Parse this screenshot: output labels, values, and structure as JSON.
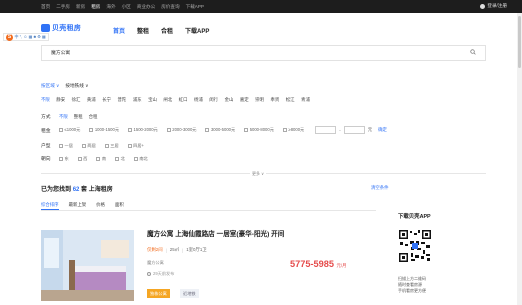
{
  "topnav": {
    "items": [
      "首页",
      "二手房",
      "新房",
      "租房",
      "海外",
      "小区",
      "商业办公",
      "房价查询",
      "下载APP"
    ],
    "active_index": 3,
    "login": "登录/注册"
  },
  "ime": {
    "logo": "S",
    "glyphs": "中 °, ☺ ▦ ♣ ⚙ ▦"
  },
  "header": {
    "logo": "贝壳租房",
    "nav": [
      "首页",
      "整租",
      "合租",
      "下载APP"
    ],
    "active_index": 0
  },
  "search": {
    "value": "魔方公寓"
  },
  "filters": {
    "tabs": [
      "按区域 ∨",
      "按地铁线 ∨"
    ],
    "districts": [
      "不限",
      "静安",
      "徐汇",
      "黄浦",
      "长宁",
      "普陀",
      "浦东",
      "宝山",
      "闸北",
      "虹口",
      "杨浦",
      "闵行",
      "金山",
      "嘉定",
      "崇明",
      "奉贤",
      "松江",
      "青浦"
    ],
    "method": {
      "label": "方式",
      "options": [
        "不限",
        "整租",
        "合租"
      ]
    },
    "rent": {
      "label": "租金",
      "options": [
        "≤1000元",
        "1000-1500元",
        "1500-2000元",
        "2000-3000元",
        "3000-5000元",
        "5000-8000元",
        "≥8000元"
      ],
      "dash": "-",
      "unit": "元",
      "confirm": "确定"
    },
    "layout": {
      "label": "户型",
      "options": [
        "一居",
        "两居",
        "三居",
        "四居+"
      ]
    },
    "orientation": {
      "label": "朝向",
      "options": [
        "东",
        "西",
        "南",
        "北",
        "南北"
      ]
    },
    "more": "更多 ∨"
  },
  "results": {
    "prefix": "已为您找到",
    "count": "62",
    "suffix": "套 上海租房",
    "clear": "清空条件",
    "sort": [
      "综合排序",
      "最新上架",
      "价格",
      "面积"
    ]
  },
  "listing": {
    "title": "魔方公寓 上海仙霞路店 一居室(豪华-阳光) 开间",
    "type": "仅剩2间",
    "area": "25㎡",
    "rooms": "1室0厅1卫",
    "brand": "魔方公寓",
    "updated": "29天前发布",
    "price": "5775-5985",
    "unit": "元/月",
    "tags": [
      "独栋公寓",
      "近地铁"
    ]
  },
  "sidebar": {
    "title": "下载贝壳APP",
    "desc_line1": "扫描上方二维码",
    "desc_line2": "随时查看房源",
    "desc_line3": "手机看房更方便"
  },
  "colors": {
    "accent": "#3072f6",
    "price": "#e54b4b",
    "topbar": "#1d1d1d",
    "tag": "#f5a623"
  }
}
